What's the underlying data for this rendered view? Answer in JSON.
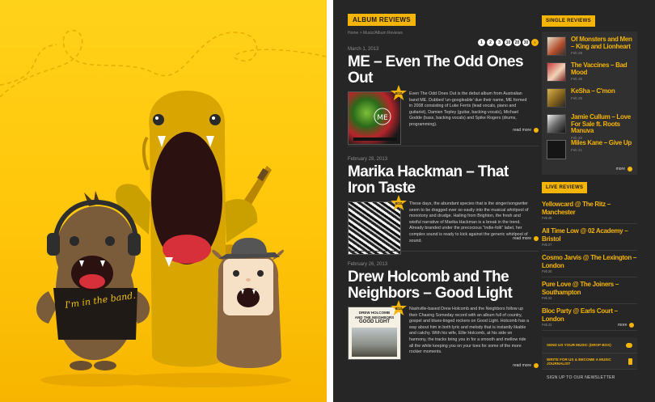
{
  "illustration": {
    "shirt_text": "I'm in the band.",
    "colors": {
      "background": "#ffc60a",
      "tall_monster": "#d6a300",
      "band_monster": "#7a5c3a",
      "small_monster": "#8a6642"
    }
  },
  "site": {
    "accent": "#f5b400",
    "background": "#262626",
    "section_label": "ALBUM REVIEWS",
    "breadcrumb": "Home > Music/Album Reviews",
    "pager": [
      "1",
      "2",
      "3",
      "10",
      "20",
      "30",
      "›"
    ],
    "reviews": [
      {
        "date": "March 1, 2013",
        "title": "ME – Even The Odd Ones Out",
        "score": "8/10",
        "text": "Even The Odd Ones Out is the debut album from Australian band ME. Dubbed 'un-googleable' due their name, ME formed in 2008 consisting of Luke Ferris (lead vocals, piano and guitarist), Damien Tepley (guitar, backing vocals), Michael Godde (bass, backing vocals) and Spike Rogers (drums, programming).",
        "read_more": "read more"
      },
      {
        "date": "February 28, 2013",
        "title": "Marika Hackman – That Iron Taste",
        "score": "8/10",
        "text": "These days, the abundant species that is the singer/songwriter seem to be dragged ever so easily into the musical whirlpool of monotony and drudge. Hailing from Brighton, the fresh and wistful narrative of Marika Hackman is a break in the trend. Already branded under the precocious \"indie-folk\" label, her complex sound is ready to kick against the generic whirlpool of sound.",
        "read_more": "read more"
      },
      {
        "date": "February 26, 2013",
        "title": "Drew Holcomb and The Neighbors – Good Light",
        "score": "8/10",
        "cover_text": [
          "DREW HOLCOMB",
          "AND THE NEIGHBORS",
          "GOOD LIGHT"
        ],
        "text": "Nashville-based Drew Holcomb and the Neighbors follow up their Chasing Someday record with an album full of country, gospel and blues-tinged rockers on Good Light. Holcomb has a way about him in both lyric and melody that is instantly likable and catchy. With his wife, Ellie Holcomb, at his side on harmony, the tracks bring you in for a smooth and mellow ride all the while keeping you on your toes for some of the more rockier moments.",
        "read_more": "read more"
      }
    ],
    "sidebar": {
      "singles_label": "SINGLE REVIEWS",
      "singles": [
        {
          "title": "Of Monsters and Men – King and Lionheart",
          "date": "Feb 28"
        },
        {
          "title": "The Vaccines – Bad Mood",
          "date": "Feb 26"
        },
        {
          "title": "KeSha – C'mon",
          "date": "Feb 25"
        },
        {
          "title": "Jamie Cullum – Love For Sale ft. Roots Manuva",
          "date": "Feb 22"
        },
        {
          "title": "Miles Kane – Give Up",
          "date": "Feb 21"
        }
      ],
      "more_label": "more",
      "live_label": "LIVE REVIEWS",
      "live": [
        {
          "title": "Yellowcard @ The Ritz – Manchester",
          "date": "Feb 28"
        },
        {
          "title": "All Time Low @ 02 Academy – Bristol",
          "date": "Feb 27"
        },
        {
          "title": "Cosmo Jarvis @ The Lexington – London",
          "date": "Feb 25"
        },
        {
          "title": "Pure Love @ The Joiners – Southampton",
          "date": "Feb 24"
        },
        {
          "title": "Bloc Party @ Earls Court – London",
          "date": "Feb 22"
        }
      ],
      "links": [
        {
          "label": "SEND US YOUR MUSIC (DROP BOX)"
        },
        {
          "label": "WRITE FOR US & BECOME A MUSIC JOURNALIST"
        }
      ],
      "newsletter": "SIGN UP TO OUR NEWSLETTER"
    }
  }
}
